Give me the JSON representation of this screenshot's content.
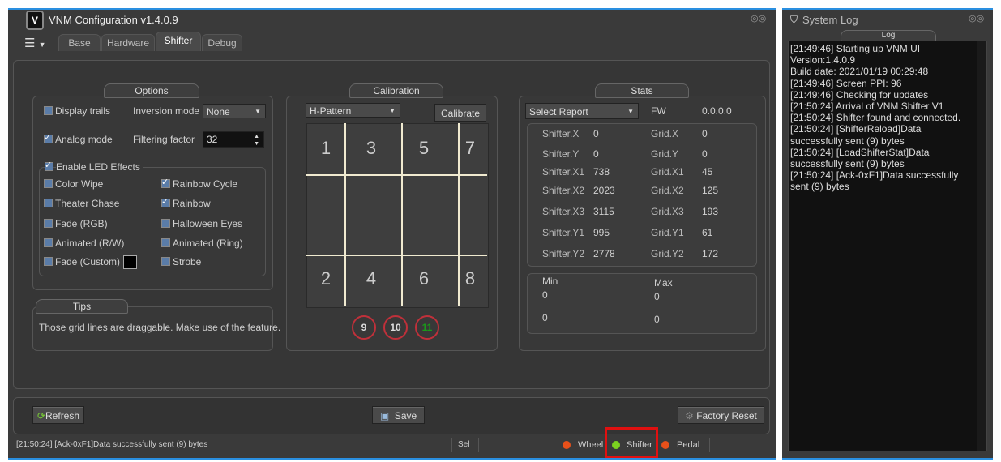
{
  "main_window": {
    "title": "VNM Configuration v1.4.0.9"
  },
  "tabs": [
    "Base",
    "Hardware",
    "Shifter",
    "Debug"
  ],
  "options": {
    "title": "Options",
    "display_trails": "Display trails",
    "inversion_mode_label": "Inversion mode",
    "inversion_mode_value": "None",
    "analog_mode": "Analog mode",
    "filtering_factor_label": "Filtering factor",
    "filtering_factor_value": "32",
    "enable_led": "Enable LED Effects",
    "effects": [
      {
        "label": "Color Wipe",
        "checked": false
      },
      {
        "label": "Rainbow Cycle",
        "checked": true
      },
      {
        "label": "Theater Chase",
        "checked": false
      },
      {
        "label": "Rainbow",
        "checked": true
      },
      {
        "label": "Fade (RGB)",
        "checked": false
      },
      {
        "label": "Halloween Eyes",
        "checked": false
      },
      {
        "label": "Animated (R/W)",
        "checked": false
      },
      {
        "label": "Animated (Ring)",
        "checked": false
      },
      {
        "label": "Fade (Custom)",
        "checked": false
      },
      {
        "label": "Strobe",
        "checked": false
      }
    ]
  },
  "tips": {
    "title": "Tips",
    "text": "Those grid lines are draggable. Make use of  the feature."
  },
  "calibration": {
    "title": "Calibration",
    "pattern": "H-Pattern",
    "calibrate": "Calibrate",
    "top": [
      "1",
      "3",
      "5",
      "7"
    ],
    "bottom": [
      "2",
      "4",
      "6",
      "8"
    ],
    "extra": [
      "9",
      "10",
      "11"
    ]
  },
  "stats": {
    "title": "Stats",
    "report": "Select Report",
    "fw_label": "FW",
    "fw_value": "0.0.0.0",
    "rows": [
      [
        "Shifter.X",
        "0",
        "Grid.X",
        "0"
      ],
      [
        "Shifter.Y",
        "0",
        "Grid.Y",
        "0"
      ],
      [
        "Shifter.X1",
        "738",
        "Grid.X1",
        "45"
      ],
      [
        "Shifter.X2",
        "2023",
        "Grid.X2",
        "125"
      ],
      [
        "Shifter.X3",
        "3115",
        "Grid.X3",
        "193"
      ],
      [
        "Shifter.Y1",
        "995",
        "Grid.Y1",
        "61"
      ],
      [
        "Shifter.Y2",
        "2778",
        "Grid.Y2",
        "172"
      ]
    ],
    "min_label": "Min",
    "max_label": "Max",
    "min": [
      "0",
      "0"
    ],
    "max": [
      "0",
      "0"
    ]
  },
  "buttons": {
    "refresh": "Refresh",
    "save": "Save",
    "factory_reset": "Factory Reset"
  },
  "status": {
    "message": "[21:50:24] [Ack-0xF1]Data successfully sent (9) bytes",
    "sel": "Sel",
    "wheel": "Wheel",
    "shifter": "Shifter",
    "pedal": "Pedal"
  },
  "colors": {
    "led_red": "#e8501a",
    "led_green": "#7cd020",
    "highlight": "#e01010"
  },
  "log": {
    "title": "System Log",
    "header": "Log",
    "lines": [
      "[21:49:46] Starting up VNM UI",
      "Version:1.4.0.9",
      "Build date: 2021/01/19 00:29:48",
      "[21:49:46] Screen PPI: 96",
      "[21:49:46] Checking for updates",
      "[21:50:24] Arrival of VNM Shifter V1",
      "[21:50:24] Shifter found and connected.",
      "[21:50:24] [ShifterReload]Data successfully sent (9) bytes",
      "[21:50:24] [LoadShifterStat]Data successfully sent (9) bytes",
      "[21:50:24] [Ack-0xF1]Data successfully sent (9) bytes"
    ]
  }
}
